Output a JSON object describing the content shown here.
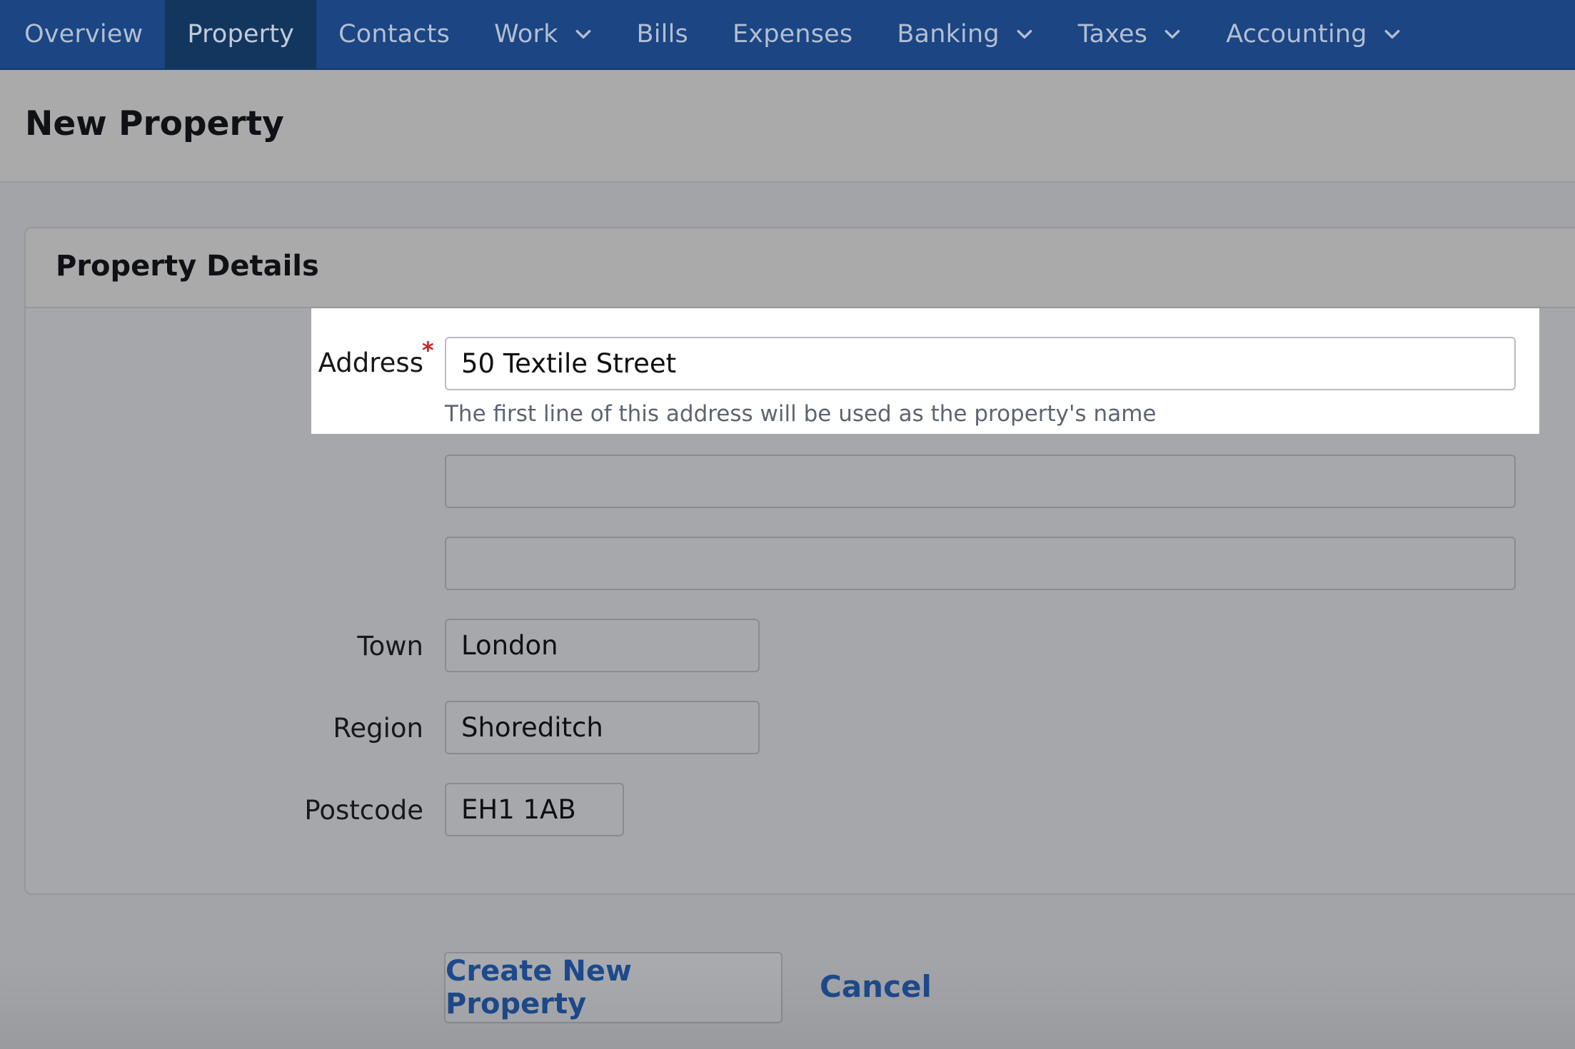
{
  "nav": {
    "items": [
      {
        "label": "Overview",
        "dropdown": false,
        "active": false
      },
      {
        "label": "Property",
        "dropdown": false,
        "active": true
      },
      {
        "label": "Contacts",
        "dropdown": false,
        "active": false
      },
      {
        "label": "Work",
        "dropdown": true,
        "active": false
      },
      {
        "label": "Bills",
        "dropdown": false,
        "active": false
      },
      {
        "label": "Expenses",
        "dropdown": false,
        "active": false
      },
      {
        "label": "Banking",
        "dropdown": true,
        "active": false
      },
      {
        "label": "Taxes",
        "dropdown": true,
        "active": false
      },
      {
        "label": "Accounting",
        "dropdown": true,
        "active": false
      }
    ],
    "dropdown_icon": "chevron-down-icon"
  },
  "page": {
    "title": "New Property"
  },
  "panel": {
    "title": "Property Details",
    "address": {
      "label": "Address",
      "required_mark": "*",
      "line1": "50 Textile Street",
      "line2": "",
      "line3": "",
      "help": "The first line of this address will be used as the property's name"
    },
    "town": {
      "label": "Town",
      "value": "London"
    },
    "region": {
      "label": "Region",
      "value": "Shoreditch"
    },
    "postcode": {
      "label": "Postcode",
      "value": "EH1 1AB"
    }
  },
  "actions": {
    "create_label": "Create New Property",
    "cancel_label": "Cancel"
  },
  "colors": {
    "nav_bg": "#1b4583",
    "nav_active_bg": "#13365f",
    "link_blue": "#1d4a8c",
    "required_red": "#c0282c",
    "overlay_bg": "#a3a4a8"
  }
}
